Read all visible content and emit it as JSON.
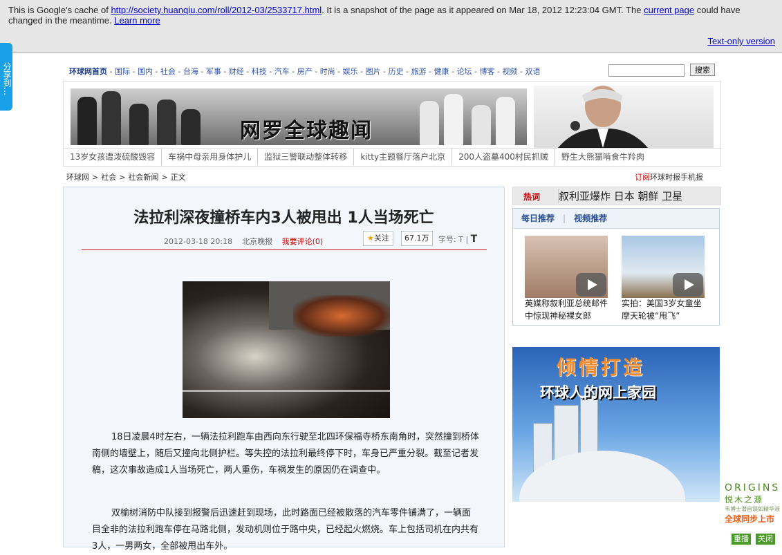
{
  "cache_banner": {
    "prefix": "This is Google's cache of",
    "url": "http://society.huanqiu.com/roll/2012-03/2533717.html",
    "middle": ". It is a snapshot of the page as it appeared on Mar 18, 2012 12:23:04 GMT. The",
    "current_page": "current page",
    "suffix": "could have changed in the meantime.",
    "learn_more": "Learn more",
    "text_only": "Text-only version"
  },
  "share_tab": {
    "label": "分享到…"
  },
  "topnav": {
    "home": "环球网首页",
    "items": [
      "国际",
      "国内",
      "社会",
      "台海",
      "军事",
      "财经",
      "科技",
      "汽车",
      "房产",
      "时尚",
      "娱乐",
      "图片",
      "历史",
      "旅游",
      "健康",
      "论坛",
      "博客",
      "视频",
      "双语"
    ],
    "search_button": "搜索"
  },
  "masthead": {
    "slogan": "网罗全球趣闻",
    "hotlinks": [
      "13岁女孩遭泼硫酸毁容",
      "车祸中母亲用身体护儿",
      "监狱三警联动整体转移",
      "kitty主题餐厅落户北京",
      "200人盗墓400村民抓贼",
      "野生大熊猫啃食牛羚肉"
    ]
  },
  "breadcrumb": {
    "items": [
      "环球网",
      "社会",
      "社会新闻",
      "正文"
    ],
    "sep": ">"
  },
  "subscribe": {
    "red": "订阅",
    "rest": "环球时报手机报"
  },
  "article": {
    "title": "法拉利深夜撞桥车内3人被甩出 1人当场死亡",
    "date": "2012-03-18 20:18",
    "source": "北京晚报",
    "comment": "我要评论(0)",
    "follow": "关注",
    "follow_count": "67.1万",
    "font_size_label": "字号:",
    "font_size_small": "T",
    "font_size_large": "T",
    "paragraphs": [
      "18日凌晨4时左右，一辆法拉利跑车由西向东行驶至北四环保福寺桥东南角时，突然撞到桥体南侧的墙壁上，随后又撞向北侧护栏。等失控的法拉利最终停下时，车身已严重分裂。截至记者发稿，这次事故造成1人当场死亡，两人重伤，车祸发生的原因仍在调查中。",
      "双榆树消防中队接到报警后迅速赶到现场，此时路面已经被散落的汽车零件铺满了，一辆面目全非的法拉利跑车停在马路北侧，发动机则位于路中央，已经起火燃烧。车上包括司机在内共有3人，一男两女，全部被甩出车外。"
    ]
  },
  "hotwords": {
    "label": "热词",
    "text": "叙利亚爆炸 日本 朝鲜 卫星"
  },
  "recommend": {
    "tabs": [
      "每日推荐",
      "视频推荐"
    ],
    "items": [
      {
        "caption": "英媒称叙利亚总统邮件中惊现神秘裸女郎"
      },
      {
        "caption": "实拍：美国3岁女童坐摩天轮被“甩飞”"
      }
    ]
  },
  "promo": {
    "headline": "倾情打造",
    "subline": "环球人的网上家园"
  },
  "side_ad": {
    "brand": "ORIGINS",
    "brand_zh": "悦木之源",
    "small": "韦博士潜自误如精华液",
    "global": "全球同步上市",
    "replay": "重播",
    "close": "关闭"
  },
  "colors": {
    "accent_red": "#cc0000",
    "link_blue": "#1a3a8c",
    "share_blue": "#1aa0e6"
  }
}
